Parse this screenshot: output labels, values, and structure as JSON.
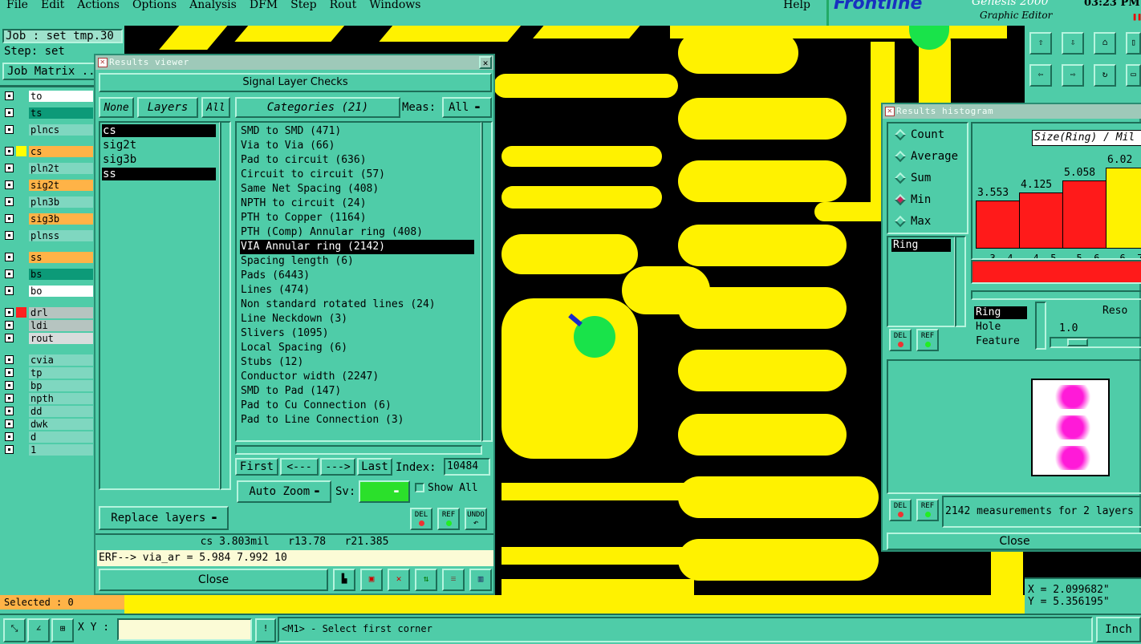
{
  "menu": [
    "File",
    "Edit",
    "Actions",
    "Options",
    "Analysis",
    "DFM",
    "Step",
    "Rout",
    "Windows"
  ],
  "help": "Help",
  "brand": {
    "logo": "Frontline",
    "product": "Genesis 2000",
    "subtitle": "Graphic Editor",
    "time": "03:23 PM"
  },
  "job": {
    "job_label": "Job : set_tmp.30",
    "step_label": "Step: set",
    "matrix_button": "Job Matrix ..."
  },
  "layers": [
    {
      "name": "to",
      "color": "#ffffff"
    },
    {
      "name": "ts",
      "color": "#0c9a78"
    },
    {
      "name": "plncs",
      "color": "#7fd7c0"
    },
    {
      "name": "cs",
      "color": "#ffb347"
    },
    {
      "name": "pln2t",
      "color": "#7fd7c0"
    },
    {
      "name": "sig2t",
      "color": "#ffb347"
    },
    {
      "name": "pln3b",
      "color": "#7fd7c0"
    },
    {
      "name": "sig3b",
      "color": "#ffb347"
    },
    {
      "name": "plnss",
      "color": "#7fd7c0"
    },
    {
      "name": "ss",
      "color": "#ffb347"
    },
    {
      "name": "bs",
      "color": "#0c9a78"
    },
    {
      "name": "bo",
      "color": "#ffffff"
    },
    {
      "name": "drl",
      "color": "#b6c4c0"
    },
    {
      "name": "ldi",
      "color": "#b6c4c0"
    },
    {
      "name": "rout",
      "color": "#d8dcdc"
    },
    {
      "name": "cvia",
      "color": "#7fd7c0"
    },
    {
      "name": "tp",
      "color": "#7fd7c0"
    },
    {
      "name": "bp",
      "color": "#7fd7c0"
    },
    {
      "name": "npth",
      "color": "#7fd7c0"
    },
    {
      "name": "dd",
      "color": "#7fd7c0"
    },
    {
      "name": "dwk",
      "color": "#7fd7c0"
    },
    {
      "name": "d",
      "color": "#7fd7c0"
    },
    {
      "name": "1",
      "color": "#7fd7c0"
    }
  ],
  "selected": "Selected : 0",
  "results_viewer": {
    "title": "Results viewer",
    "header": "Signal Layer Checks",
    "none": "None",
    "layers": "Layers",
    "all": "All",
    "categories_label": "Categories (21)",
    "meas_label": "Meas:",
    "meas_value": "All",
    "layer_list": [
      "cs",
      "sig2t",
      "sig3b",
      "ss"
    ],
    "categories": [
      "SMD to SMD (471)",
      "Via to Via (66)",
      "Pad to circuit (636)",
      "Circuit to circuit (57)",
      "Same Net Spacing (408)",
      "NPTH to circuit (24)",
      "PTH to Copper (1164)",
      "PTH (Comp) Annular ring (408)",
      "VIA Annular ring (2142)",
      "Spacing length (6)",
      "Pads (6443)",
      "Lines (474)",
      "Non standard rotated lines (24)",
      "Line Neckdown (3)",
      "Slivers (1095)",
      "Local Spacing (6)",
      "Stubs (12)",
      "Conductor width (2247)",
      "SMD to Pad (147)",
      "Pad to Cu Connection (6)",
      "Pad to Line Connection (3)"
    ],
    "first": "First",
    "prev": "<---",
    "next": "--->",
    "last": "Last",
    "index_label": "Index:",
    "index_value": "10484",
    "auto_zoom": "Auto Zoom",
    "sv_label": "Sv:",
    "show_all": "Show All",
    "replace_layers": "Replace layers",
    "del": "DEL",
    "ref": "REF",
    "undo": "UNDO",
    "status": "cs 3.803mil   r13.78   r21.385",
    "erf": "ERF--> via_ar = 5.984 7.992 10",
    "close": "Close"
  },
  "histogram": {
    "title": "Results histogram",
    "modes": [
      "Count",
      "Average",
      "Sum",
      "Min",
      "Max"
    ],
    "selected_mode": "Min",
    "axis_label": "Size(Ring) / Mil",
    "ring_list": [
      "Ring"
    ],
    "field_list": [
      "Ring",
      "Hole",
      "Feature"
    ],
    "resolution_label": "Reso",
    "resolution_value": "1.0",
    "bars": [
      {
        "label": "3.553",
        "range": "3- 4",
        "value": 3.553,
        "color": "#ff1a1a"
      },
      {
        "label": "4.125",
        "range": "4- 5",
        "value": 4.125,
        "color": "#ff1a1a"
      },
      {
        "label": "5.058",
        "range": "5- 6",
        "value": 5.058,
        "color": "#ff1a1a"
      },
      {
        "label": "6.02",
        "range": "6- 7",
        "value": 6.02,
        "color": "#fff200"
      }
    ],
    "measurements": "2142 measurements for 2 layers",
    "close": "Close"
  },
  "coords": {
    "x": "X = 2.099682\"",
    "y": "Y = 5.356195\""
  },
  "bottom": {
    "xy_label": "X Y :",
    "hint": "<M1> - Select first corner",
    "unit": "Inch"
  }
}
